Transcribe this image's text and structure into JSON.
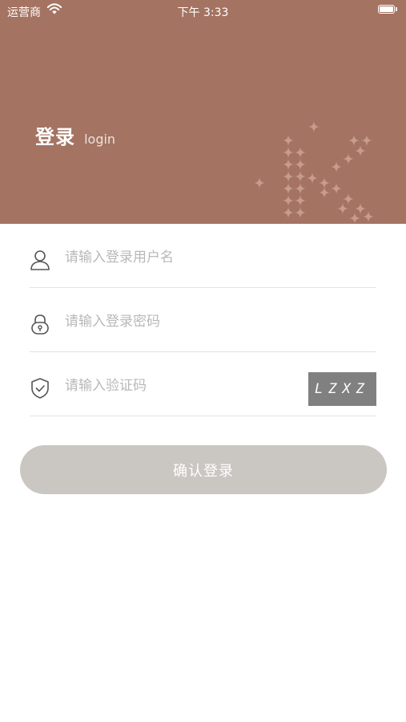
{
  "status_bar": {
    "carrier": "运营商",
    "time": "下午 3:33"
  },
  "header": {
    "title": "登录",
    "subtitle": "login"
  },
  "form": {
    "username": {
      "placeholder": "请输入登录用户名",
      "value": "",
      "icon": "user-icon"
    },
    "password": {
      "placeholder": "请输入登录密码",
      "value": "",
      "icon": "lock-icon"
    },
    "captcha": {
      "placeholder": "请输入验证码",
      "value": "",
      "icon": "shield-check-icon",
      "code": "LZXZ"
    }
  },
  "login_button": {
    "label": "确认登录"
  },
  "colors": {
    "header_bg": "#a47362",
    "button_bg": "#cac7c2",
    "captcha_bg": "#808080"
  }
}
